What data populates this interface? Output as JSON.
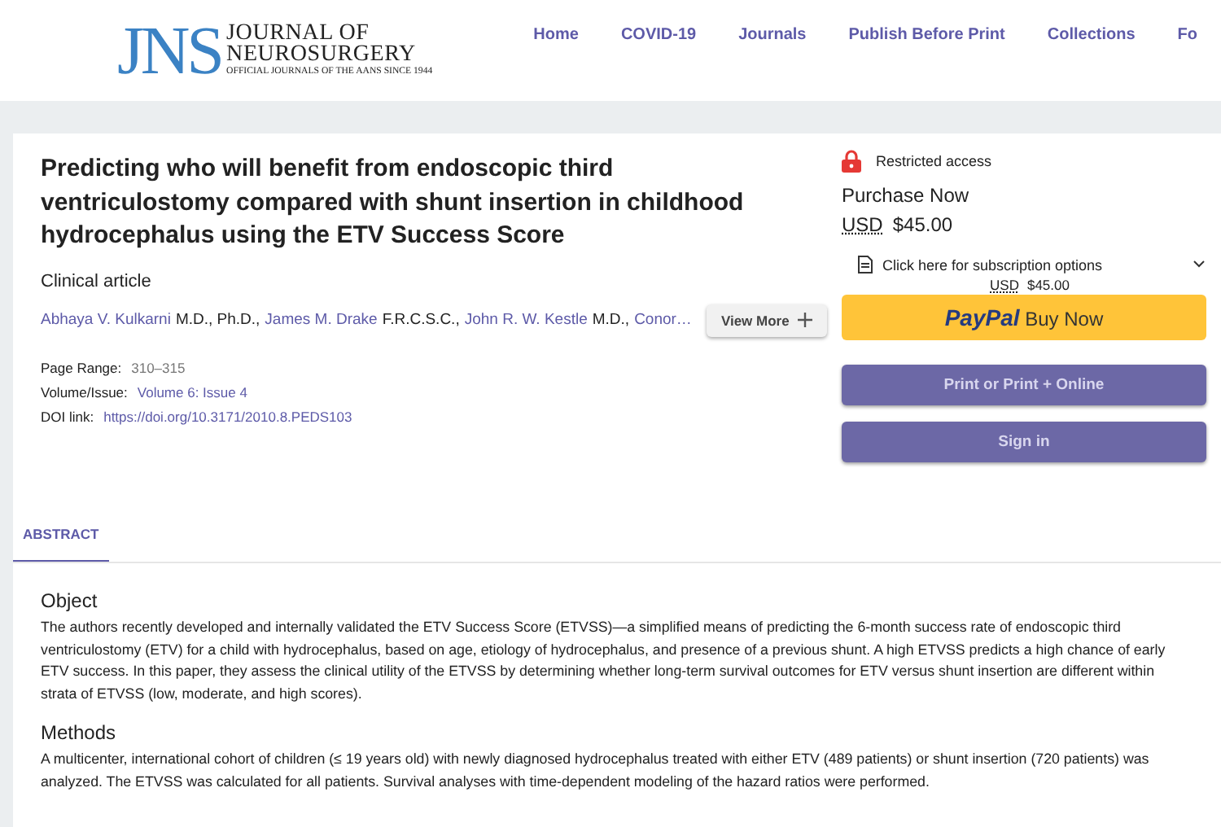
{
  "header": {
    "logo": {
      "mark": "JNS",
      "line1": "JOURNAL OF",
      "line2": "NEUROSURGERY",
      "tagline": "OFFICIAL JOURNALS OF THE AANS SINCE 1944"
    },
    "nav": [
      "Home",
      "COVID-19",
      "Journals",
      "Publish Before Print",
      "Collections",
      "Fo"
    ]
  },
  "article": {
    "title": "Predicting who will benefit from endoscopic third ventriculostomy compared with shunt insertion in childhood hydrocephalus using the ETV Success Score",
    "type": "Clinical article",
    "authors": [
      {
        "name": "Abhaya V. Kulkarni",
        "degree": "M.D., Ph.D.,"
      },
      {
        "name": "James M. Drake",
        "degree": "F.R.C.S.C.,"
      },
      {
        "name": "John R. W. Kestle",
        "degree": "M.D.,"
      },
      {
        "name": "Conor…"
      }
    ],
    "view_more": "View More",
    "meta": [
      {
        "label": "Page Range:",
        "value": "310–315",
        "link": false
      },
      {
        "label": "Volume/Issue:",
        "value": "Volume 6: Issue 4",
        "link": true
      },
      {
        "label": "DOI link:",
        "value": "https://doi.org/10.3171/2010.8.PEDS103",
        "link": true
      }
    ]
  },
  "access": {
    "restricted": "Restricted access",
    "purchase": "Purchase Now",
    "currency": "USD",
    "price": "$45.00",
    "subscription": "Click here for subscription options",
    "sub_currency": "USD",
    "sub_price": "$45.00",
    "paypal_logo": "PayPal",
    "paypal_label": "Buy Now",
    "buttons": [
      "Print or Print + Online",
      "Sign in"
    ]
  },
  "tabs": [
    {
      "label": "ABSTRACT",
      "selected": true
    }
  ],
  "abstract": [
    {
      "heading": "Object",
      "text": "The authors recently developed and internally validated the ETV Success Score (ETVSS)—a simplified means of predicting the 6-month success rate of endoscopic third ventriculostomy (ETV) for a child with hydrocephalus, based on age, etiology of hydrocephalus, and presence of a previous shunt. A high ETVSS predicts a high chance of early ETV success. In this paper, they assess the clinical utility of the ETVSS by determining whether long-term survival outcomes for ETV versus shunt insertion are different within strata of ETVSS (low, moderate, and high scores)."
    },
    {
      "heading": "Methods",
      "text": "A multicenter, international cohort of children (≤ 19 years old) with newly diagnosed hydrocephalus treated with either ETV (489 patients) or shunt insertion (720 patients) was analyzed. The ETVSS was calculated for all patients. Survival analyses with time-dependent modeling of the hazard ratios were performed."
    }
  ]
}
